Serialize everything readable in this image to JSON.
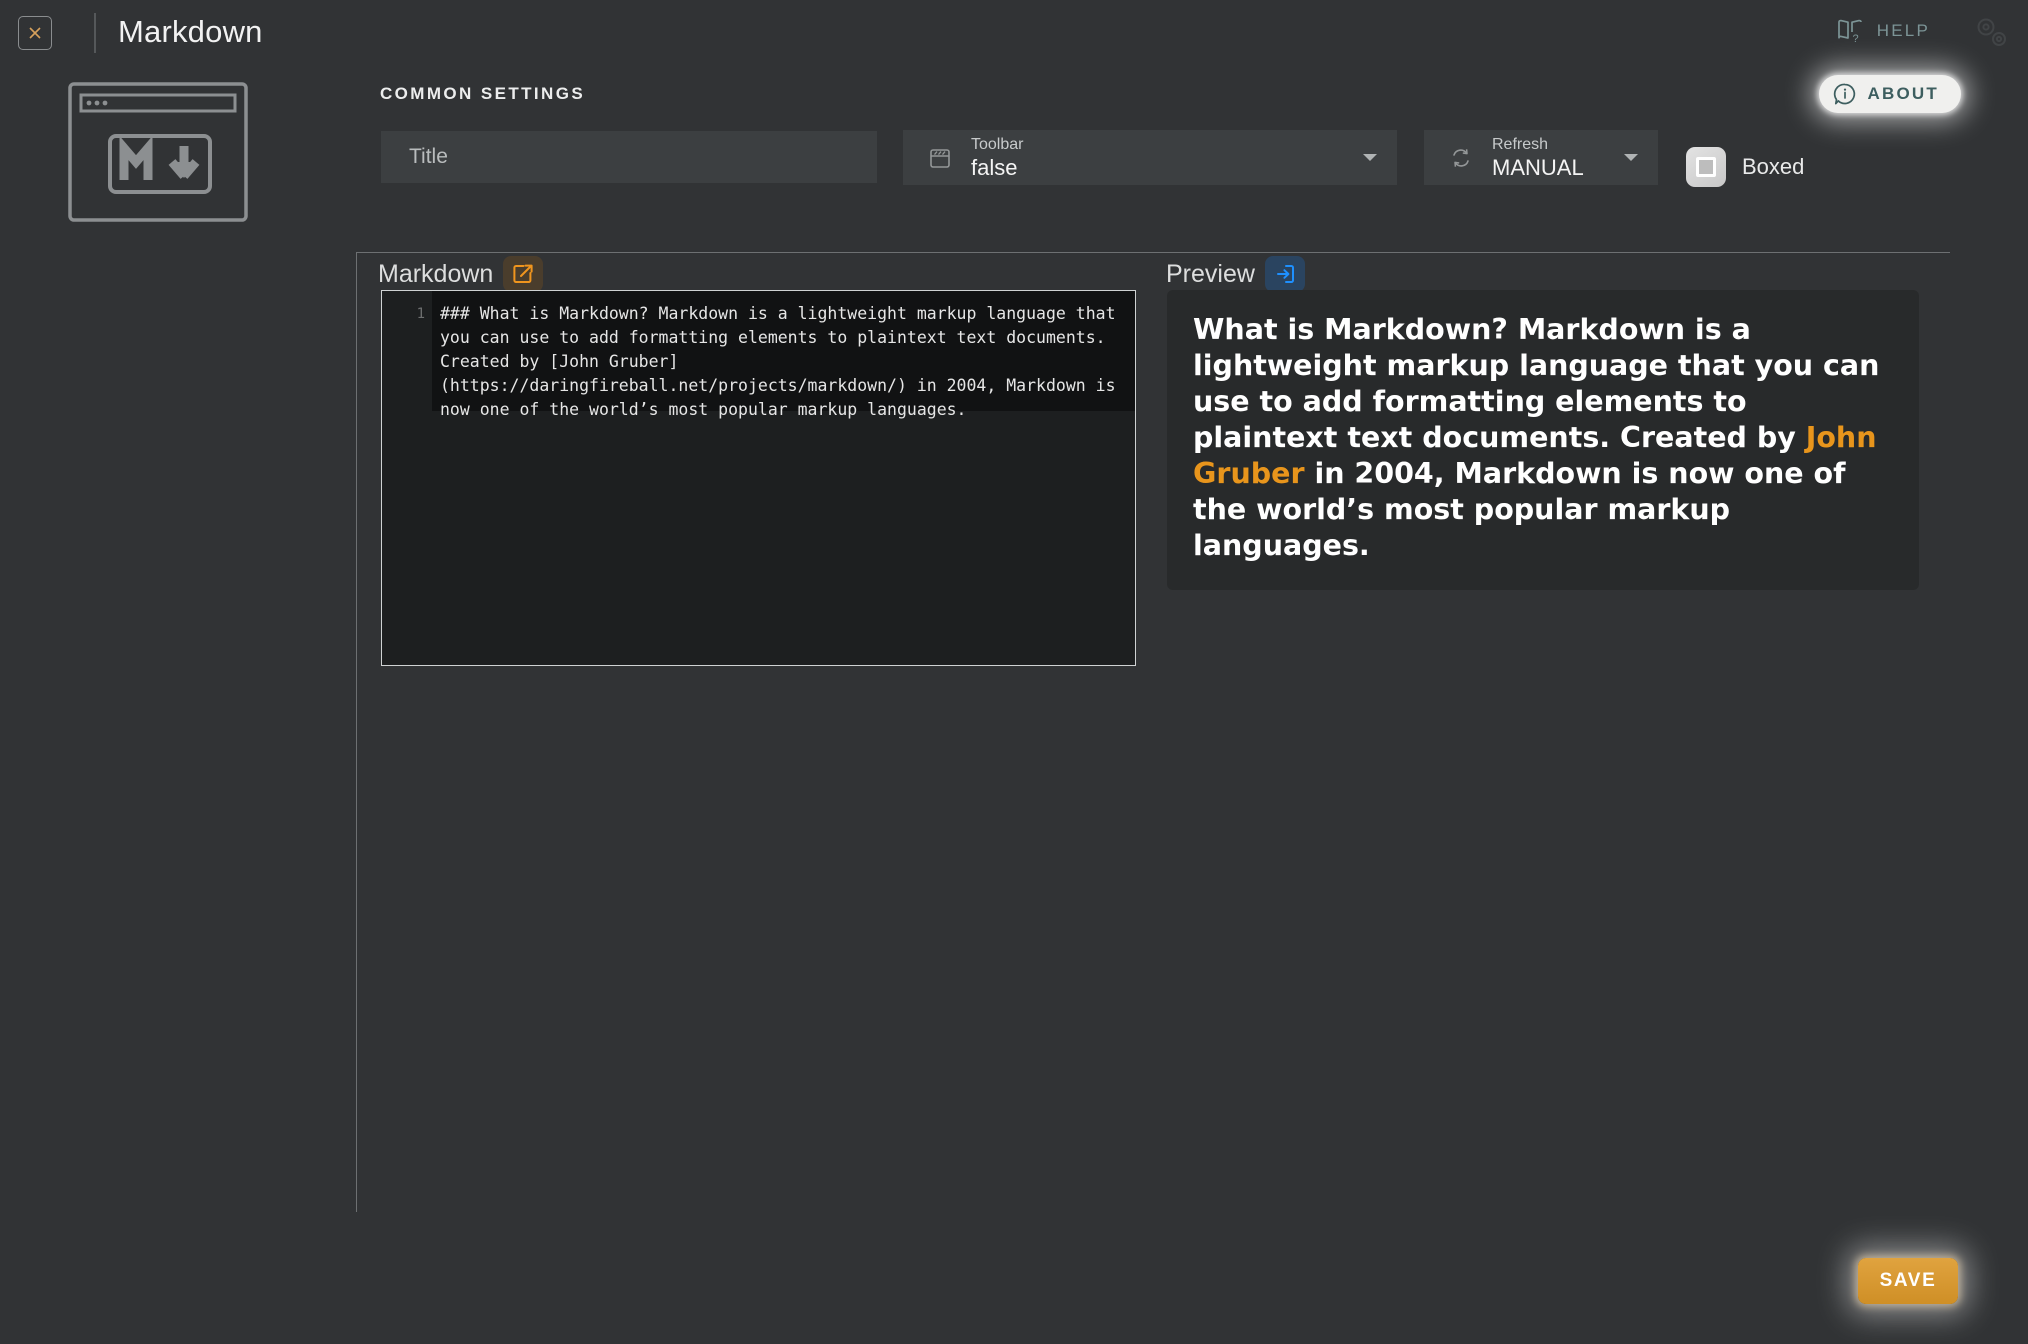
{
  "window": {
    "title": "Markdown",
    "close_icon": "close-x-icon",
    "logo_icon": "markdown-browser-logo-icon"
  },
  "header": {
    "help_label": "HELP",
    "help_icon": "book-question-icon",
    "about_label": "ABOUT",
    "about_icon": "info-bubble-icon",
    "cogs_icon": "gears-icon"
  },
  "settings": {
    "section_label": "COMMON SETTINGS",
    "title_field": {
      "placeholder": "Title",
      "value": ""
    },
    "toolbar": {
      "label": "Toolbar",
      "value": "false",
      "icon": "toolbar-window-icon"
    },
    "refresh": {
      "label": "Refresh",
      "value": "MANUAL",
      "icon": "refresh-cycle-icon"
    },
    "boxed": {
      "label": "Boxed",
      "checked": false,
      "icon": "checkbox-square-icon"
    }
  },
  "panels": {
    "markdown": {
      "title": "Markdown",
      "chip_icon": "external-link-icon",
      "chip_color": "#f0951e",
      "line_numbers": [
        "1"
      ],
      "source": "### What is Markdown? Markdown is a lightweight markup language that you can use to add formatting elements to plaintext text documents. Created by [John Gruber](https://daringfireball.net/projects/markdown/) in 2004, Markdown is now one of the world’s most popular markup languages."
    },
    "preview": {
      "title": "Preview",
      "chip_icon": "arrow-into-box-icon",
      "chip_color": "#1e90ff",
      "heading_before": "What is Markdown? Markdown is a lightweight markup language that you can use to add formatting elements to plaintext text documents. Created by ",
      "link_text": "John Gruber",
      "link_color": "#e8951c",
      "heading_after": " in 2004, Markdown is now one of the world’s most popular markup languages."
    }
  },
  "footer": {
    "save_label": "SAVE"
  },
  "colors": {
    "background": "#313335",
    "panel": "#3c3f41",
    "accent_orange": "#e8951c",
    "accent_blue": "#1e90ff",
    "teal_text": "#7c9496"
  }
}
